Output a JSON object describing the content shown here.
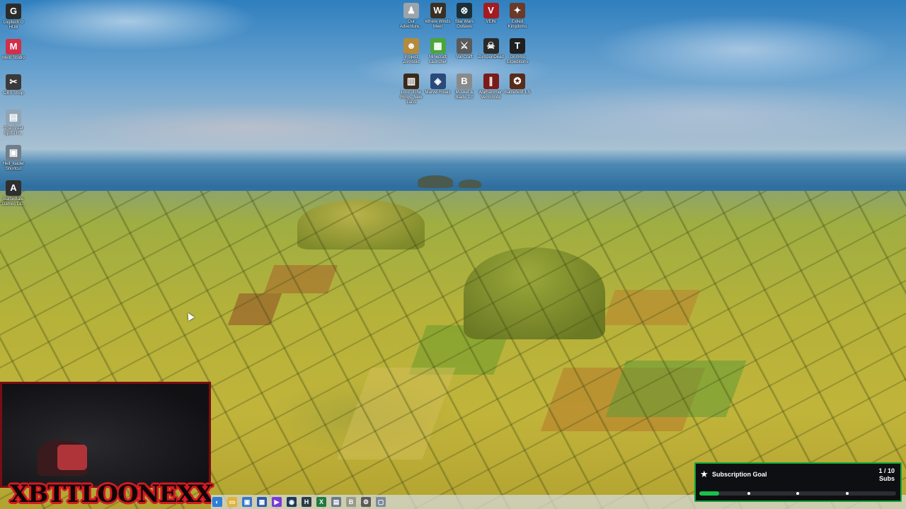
{
  "desktop": {
    "left_icons": [
      {
        "label": "Logitech G HUB",
        "icon": "logitech-g-icon",
        "glyph": "G",
        "color": "#2b2b2b"
      },
      {
        "label": "Meld Studio",
        "icon": "meld-studio-icon",
        "glyph": "M",
        "color": "#d12f4a"
      },
      {
        "label": "OBS Shop",
        "icon": "obs-shop-icon",
        "glyph": "✂",
        "color": "#3a3a3a"
      },
      {
        "label": "The Great Spiffo R...",
        "icon": "document-icon",
        "glyph": "▤",
        "color": "#8fa6b8"
      },
      {
        "label": "Hell_loader Shortcut",
        "icon": "shortcut-icon",
        "glyph": "▣",
        "color": "#6f7d8c"
      },
      {
        "label": "Battlestate Games La...",
        "icon": "battlestate-icon",
        "glyph": "A",
        "color": "#2f2f2f"
      }
    ],
    "grid_icons": [
      {
        "label": "Our Adventure...",
        "icon": "game-icon",
        "glyph": "♟",
        "color": "#9aa4ab"
      },
      {
        "label": "Where Winds Meet",
        "icon": "game-icon",
        "glyph": "W",
        "color": "#3a3022"
      },
      {
        "label": "Star Wars Outlaws",
        "icon": "game-icon",
        "glyph": "⊗",
        "color": "#1a2f38"
      },
      {
        "label": "VEIN",
        "icon": "game-icon",
        "glyph": "V",
        "color": "#a31c22"
      },
      {
        "label": "Exiled Kingdoms",
        "icon": "game-icon",
        "glyph": "✦",
        "color": "#6a3a2a"
      },
      {
        "label": "Project Zomboid",
        "icon": "game-icon",
        "glyph": "☻",
        "color": "#b58a3a"
      },
      {
        "label": "Minecraft Launcher",
        "icon": "minecraft-icon",
        "glyph": "▦",
        "color": "#4aa53a"
      },
      {
        "label": "VanCraft",
        "icon": "game-icon",
        "glyph": "⚔",
        "color": "#5a5a5a"
      },
      {
        "label": "ZumpunDead",
        "icon": "game-icon",
        "glyph": "☠",
        "color": "#2a2a2a"
      },
      {
        "label": "Grimms Expeditions",
        "icon": "game-icon",
        "glyph": "T",
        "color": "#1f1f1f"
      },
      {
        "label": "Lord of the Rings: New Land",
        "icon": "game-icon",
        "glyph": "▥",
        "color": "#3a2a1a"
      },
      {
        "label": "Marvel Rivals",
        "icon": "game-icon",
        "glyph": "◈",
        "color": "#2a4a7a"
      },
      {
        "label": "Musket & Blade 1.0",
        "icon": "game-icon",
        "glyph": "B",
        "color": "#8a8a8a"
      },
      {
        "label": "Warhammer: Vermintide",
        "icon": "game-icon",
        "glyph": "∥",
        "color": "#7a1a1a"
      },
      {
        "label": "Battlefield 1.5",
        "icon": "game-icon",
        "glyph": "✪",
        "color": "#5a2a1a"
      }
    ]
  },
  "subscription_goal": {
    "title": "Subscription Goal",
    "count": "1 / 10",
    "unit": "Subs",
    "progress": 0.1,
    "milestones": [
      0.25,
      0.5,
      0.75
    ],
    "accent": "#0ea53a"
  },
  "overlay": {
    "channel_logo": "XBTTLOONEXX"
  },
  "taskbar": {
    "items": [
      {
        "icon": "edge-icon",
        "glyph": "◐",
        "color": "#2d7fd8"
      },
      {
        "icon": "file-explorer-icon",
        "glyph": "▭",
        "color": "#e0b43a"
      },
      {
        "icon": "app-icon",
        "glyph": "▣",
        "color": "#3a78c8"
      },
      {
        "icon": "store-icon",
        "glyph": "▦",
        "color": "#2a5aa8"
      },
      {
        "icon": "app-icon",
        "glyph": "▶",
        "color": "#7a3ad8"
      },
      {
        "icon": "steam-icon",
        "glyph": "◉",
        "color": "#1b3a5a"
      },
      {
        "icon": "app-icon",
        "glyph": "H",
        "color": "#2a3a4a"
      },
      {
        "icon": "excel-icon",
        "glyph": "X",
        "color": "#1f7a3f"
      },
      {
        "icon": "app-icon",
        "glyph": "▤",
        "color": "#6a7a8a"
      },
      {
        "icon": "app-icon",
        "glyph": "B",
        "color": "#9a9a8a"
      },
      {
        "icon": "gear-icon",
        "glyph": "⚙",
        "color": "#5a5a5a"
      },
      {
        "icon": "app-icon",
        "glyph": "▢",
        "color": "#7a8a9a"
      }
    ]
  }
}
